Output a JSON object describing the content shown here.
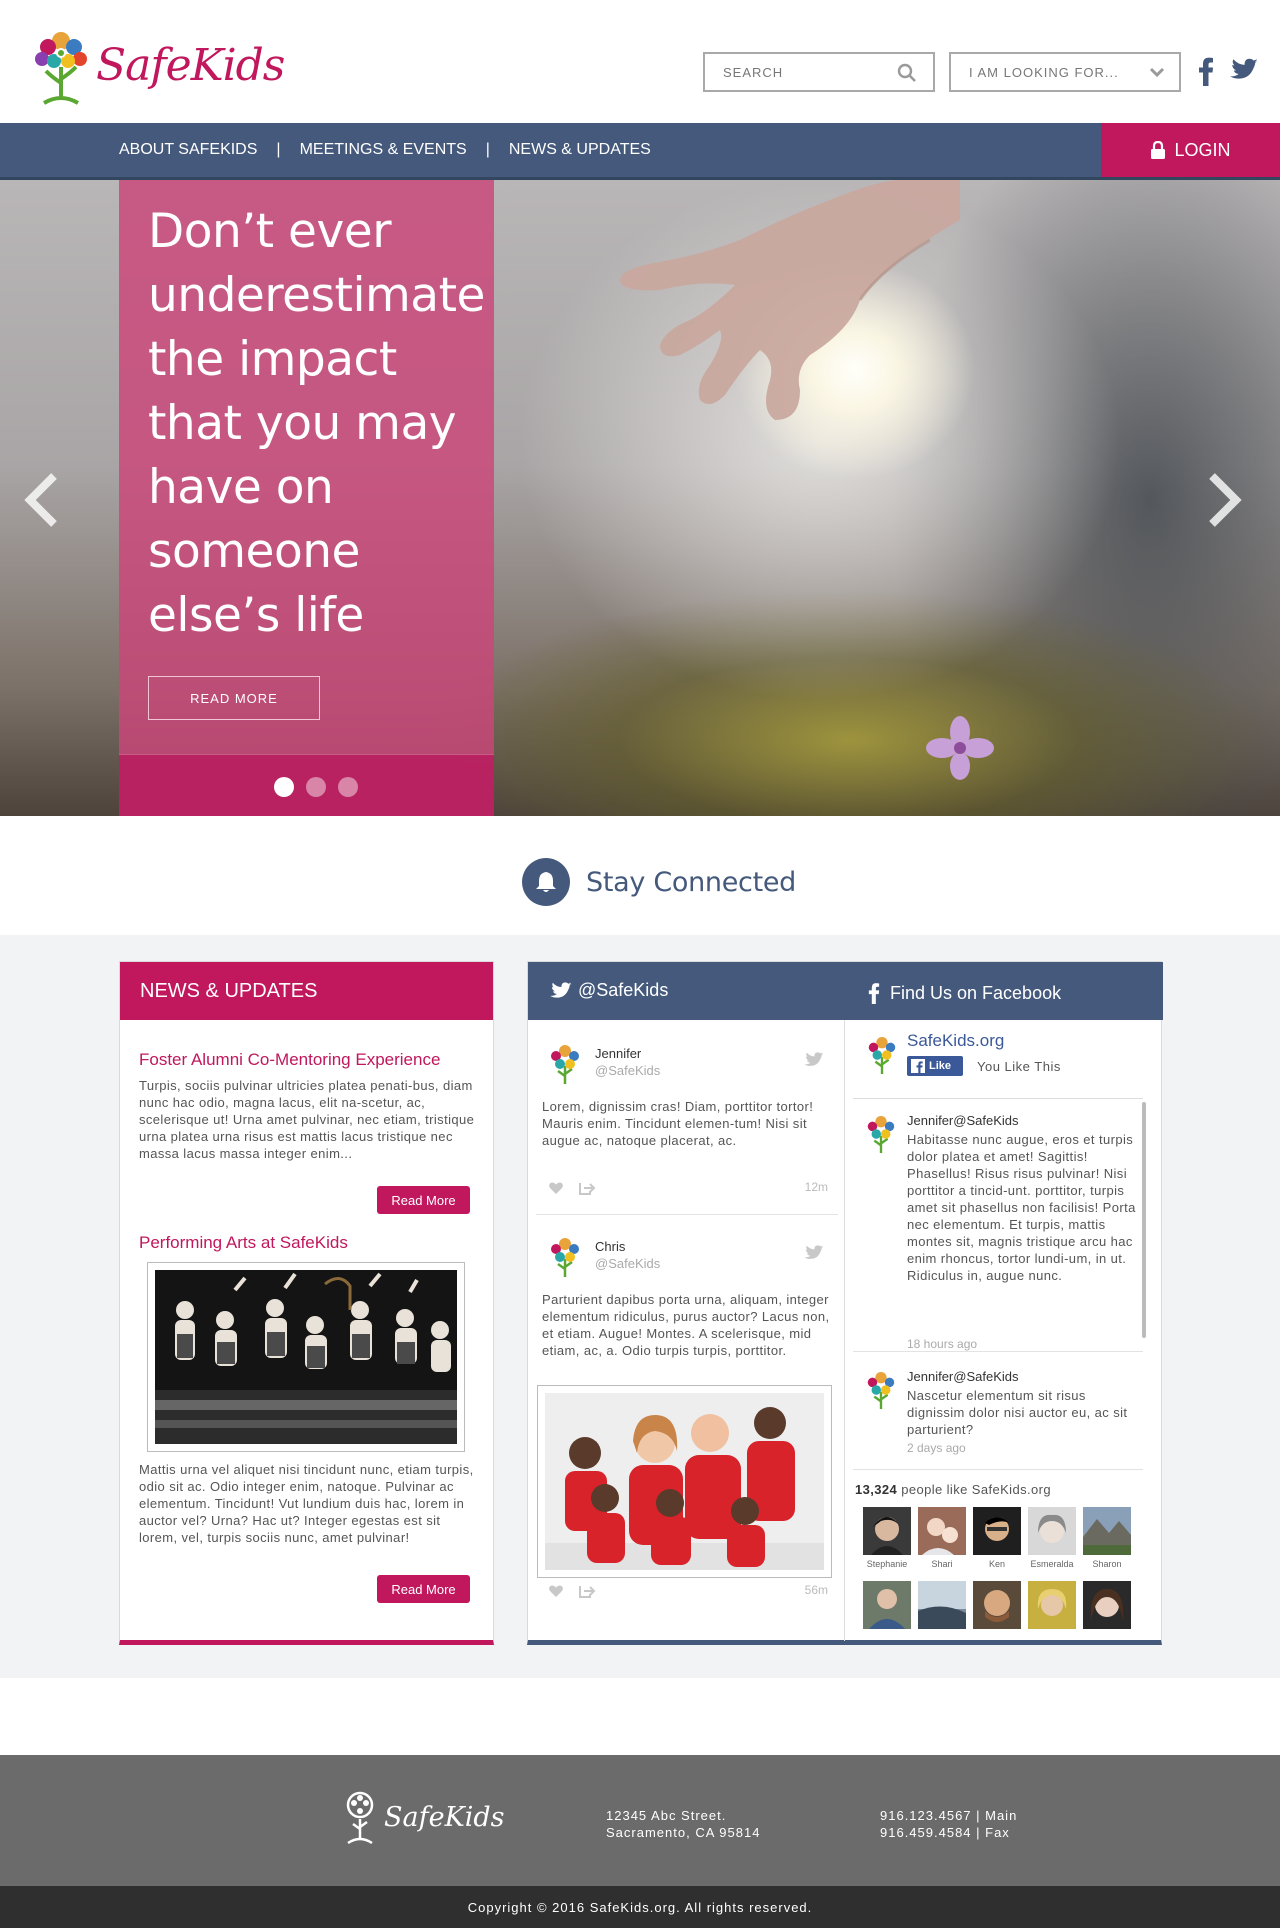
{
  "brand": {
    "name": "SafeKids",
    "accent": "#c0175d",
    "navy": "#44597b"
  },
  "header": {
    "search_placeholder": "SEARCH",
    "looking_for": "I AM LOOKING FOR...",
    "social_icons": [
      "facebook-icon",
      "twitter-icon"
    ]
  },
  "nav": {
    "items": [
      {
        "label": "ABOUT SAFEKIDS"
      },
      {
        "label": "MEETINGS & EVENTS"
      },
      {
        "label": "NEWS & UPDATES"
      }
    ],
    "separator": "|",
    "login": "LOGIN"
  },
  "hero": {
    "quote": "Don’t ever underestimate the impact that you may have on someone else’s life",
    "button": "READ MORE",
    "slides": 3,
    "active_slide": 1
  },
  "stay_connected": {
    "title": "Stay Connected"
  },
  "news": {
    "heading": "NEWS & UPDATES",
    "items": [
      {
        "title": "Foster Alumni Co-Mentoring Experience",
        "body": "Turpis, sociis pulvinar ultricies platea penati-bus, diam nunc hac odio, magna lacus, elit na-scetur, ac, scelerisque ut! Urna amet pulvinar, nec etiam, tristique urna platea urna risus est mattis lacus tristique nec massa lacus massa integer enim...",
        "button": "Read More"
      },
      {
        "title": "Performing Arts at SafeKids",
        "body": "Mattis urna vel aliquet nisi tincidunt nunc, etiam turpis, odio sit ac. Odio integer enim, natoque. Pulvinar ac elementum. Tincidunt! Vut lundium duis hac, lorem in auctor vel? Urna? Hac ut? Integer egestas est sit lorem, vel, turpis sociis nunc, amet pulvinar!",
        "button": "Read More"
      }
    ]
  },
  "twitter": {
    "heading": "@SafeKids",
    "tweets": [
      {
        "name": "Jennifer",
        "handle": "@SafeKids",
        "text": "Lorem, dignissim cras! Diam, porttitor tortor! Mauris enim. Tincidunt elemen-tum! Nisi sit augue ac, natoque placerat, ac.",
        "time": "12m"
      },
      {
        "name": "Chris",
        "handle": "@SafeKids",
        "text": "Parturient dapibus porta urna, aliquam, integer elementum ridiculus, purus auctor? Lacus non, et etiam. Augue! Montes. A scelerisque, mid etiam, ac, a. Odio turpis turpis, porttitor.",
        "time": "56m"
      }
    ]
  },
  "facebook": {
    "heading": "Find Us on Facebook",
    "page_name": "SafeKids.org",
    "like_button": "Like",
    "like_text": "You Like This",
    "posts": [
      {
        "name": "Jennifer@SafeKids",
        "text": "Habitasse nunc augue, eros et turpis dolor platea et amet! Sagittis! Phasellus! Risus risus pulvinar! Nisi porttitor a tincid-unt. porttitor, turpis amet sit phasellus non facilisis! Porta nec elementum. Et turpis, mattis montes sit, magnis tristique arcu hac enim rhoncus, tortor lundi-um, in ut. Ridiculus in, augue nunc.",
        "time": "18 hours ago"
      },
      {
        "name": "Jennifer@SafeKids",
        "text": "Nascetur elementum sit risus dignissim dolor nisi auctor eu, ac sit parturient?",
        "time": "2 days ago"
      }
    ],
    "likes_count": "13,324",
    "likes_suffix": "people like SafeKids.org",
    "fans": [
      "Stephanie",
      "Shari",
      "Ken",
      "Esmeralda",
      "Sharon"
    ]
  },
  "footer": {
    "logo_text": "SafeKids",
    "address_line1": "12345 Abc Street.",
    "address_line2": "Sacramento, CA 95814",
    "phone_main": "916.123.4567 | Main",
    "phone_fax": "916.459.4584 | Fax",
    "copyright": "Copyright © 2016 SafeKids.org. All rights reserved."
  }
}
